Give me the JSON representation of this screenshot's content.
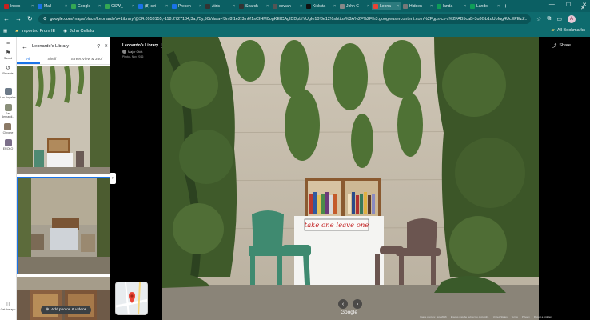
{
  "browser": {
    "tabs": [
      {
        "label": "Inbox",
        "color": "#c5221f",
        "active": false
      },
      {
        "label": "Mail -",
        "color": "#1a73e8",
        "active": false
      },
      {
        "label": "Google",
        "color": "#34a853",
        "active": false
      },
      {
        "label": "OSW_",
        "color": "#34a853",
        "active": false
      },
      {
        "label": "(8) stri",
        "color": "#1a73e8",
        "active": false
      },
      {
        "label": "Presen",
        "color": "#1a73e8",
        "active": false
      },
      {
        "label": "Atris",
        "color": "#333333",
        "active": false
      },
      {
        "label": "Search",
        "color": "#333333",
        "active": false
      },
      {
        "label": "oewah",
        "color": "#555555",
        "active": false
      },
      {
        "label": "Kicksta",
        "color": "#111111",
        "active": false
      },
      {
        "label": "John C",
        "color": "#888888",
        "active": false
      },
      {
        "label": "Leona",
        "color": "#ea4335",
        "active": true
      },
      {
        "label": "Hidden",
        "color": "#777777",
        "active": false
      },
      {
        "label": "landa",
        "color": "#0f9d58",
        "active": false
      },
      {
        "label": "Lando",
        "color": "#0f9d58",
        "active": false
      }
    ],
    "new_tab": "+",
    "url_domain": "google.com",
    "url_rest": "/maps/place/Leonardo's+Library/@34.0953155,-118.2727184,3a,75y,90t/data=!3m8!1e2!3m6!1sCIHM0ogKEICAgIDDpbiYUgIe10!3e12!6shttps%3A%2F%2Flh3.googleusercontent.com%2Fgps-cs-s%2FAB5caB-3u8Gb1uUpfug4UcEPEzZ...",
    "avatar_letter": "A",
    "bookmarks": [
      {
        "label": "Imported From IE"
      },
      {
        "label": "John Cellalu"
      }
    ],
    "all_bookmarks": "All Bookmarks"
  },
  "rail": {
    "items": [
      {
        "label": "Saved"
      },
      {
        "label": "Recents"
      }
    ],
    "places": [
      {
        "label": "Los Angeles",
        "color": "#6d7b89"
      },
      {
        "label": "San Bernardi...",
        "color": "#8a8f7a"
      },
      {
        "label": "Chrome",
        "color": "#8b7a66"
      },
      {
        "label": "EROLO",
        "color": "#7b6f8a"
      }
    ],
    "get_app": "Get the app"
  },
  "panel": {
    "search_value": "Leonardo's Library",
    "tabs": [
      {
        "label": "All",
        "active": true
      },
      {
        "label": "Shelf",
        "active": false
      },
      {
        "label": "Street View & 360°",
        "active": false
      }
    ],
    "add_photos": "Add photos & videos"
  },
  "viewer": {
    "place_title": "Leonardo's Library",
    "author": "Major Olds",
    "photo_date": "Photo - Nov 2016",
    "share_label": "Share",
    "google_logo": "Google",
    "sign_text": "take one leave one",
    "footer": [
      "Image capture: Nov 2016",
      "Images may be subject to copyright.",
      "United States",
      "Terms",
      "Privacy",
      "Report a problem"
    ]
  }
}
